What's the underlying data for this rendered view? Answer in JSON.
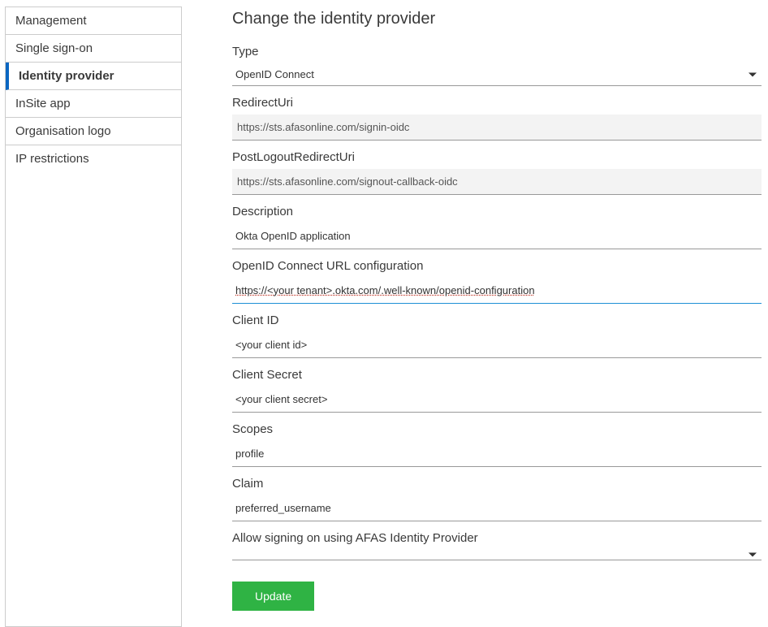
{
  "sidebar": {
    "items": [
      {
        "label": "Management"
      },
      {
        "label": "Single sign-on"
      },
      {
        "label": "Identity provider",
        "active": true
      },
      {
        "label": "InSite app"
      },
      {
        "label": "Organisation logo"
      },
      {
        "label": "IP restrictions"
      }
    ]
  },
  "page": {
    "title": "Change the identity provider"
  },
  "form": {
    "type": {
      "label": "Type",
      "value": "OpenID Connect"
    },
    "redirect_uri": {
      "label": "RedirectUri",
      "value": "https://sts.afasonline.com/signin-oidc"
    },
    "post_logout_redirect_uri": {
      "label": "PostLogoutRedirectUri",
      "value": "https://sts.afasonline.com/signout-callback-oidc"
    },
    "description": {
      "label": "Description",
      "value": "Okta OpenID application"
    },
    "openid_config_url": {
      "label": "OpenID Connect URL configuration",
      "value": "https://<your tenant>.okta.com/.well-known/openid-configuration"
    },
    "client_id": {
      "label": "Client ID",
      "value": "<your client id>"
    },
    "client_secret": {
      "label": "Client Secret",
      "value": "<your client secret>"
    },
    "scopes": {
      "label": "Scopes",
      "value": "profile"
    },
    "claim": {
      "label": "Claim",
      "value": "preferred_username"
    },
    "allow_afas_idp": {
      "label": "Allow signing on using AFAS Identity Provider",
      "value": ""
    },
    "update": "Update"
  }
}
